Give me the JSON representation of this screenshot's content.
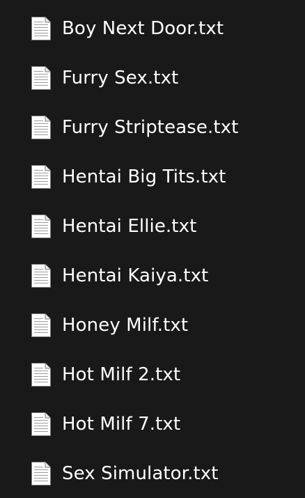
{
  "file_list": {
    "icon": "text-document-icon",
    "items": [
      {
        "name": "Boy Next Door.txt"
      },
      {
        "name": "Furry Sex.txt"
      },
      {
        "name": "Furry Striptease.txt"
      },
      {
        "name": "Hentai Big Tits.txt"
      },
      {
        "name": "Hentai Ellie.txt"
      },
      {
        "name": "Hentai Kaiya.txt"
      },
      {
        "name": "Honey Milf.txt"
      },
      {
        "name": "Hot Milf 2.txt"
      },
      {
        "name": "Hot Milf 7.txt"
      },
      {
        "name": "Sex Simulator.txt"
      }
    ]
  },
  "colors": {
    "background": "#191919",
    "text": "#ffffff",
    "icon_page": "#ffffff",
    "icon_lines": "#9a9a9a"
  }
}
